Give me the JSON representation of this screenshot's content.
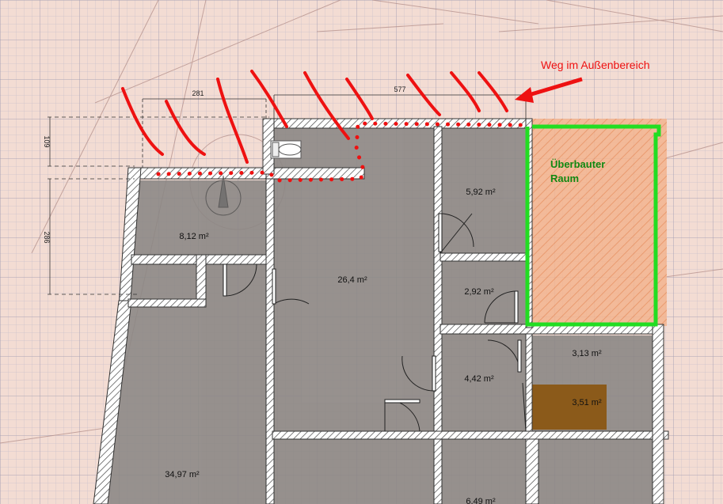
{
  "annotations": {
    "path_label": "Weg im Außenbereich",
    "overbuilt_label_line1": "Überbauter",
    "overbuilt_label_line2": "Raum"
  },
  "dimensions": {
    "top_left": "281",
    "top_right": "577",
    "side_upper": "109",
    "side_lower": "286"
  },
  "rooms": {
    "room_a": "8,12 m²",
    "room_b": "26,4 m²",
    "room_c": "5,92 m²",
    "room_d": "2,92 m²",
    "room_e": "4,42 m²",
    "room_f": "3,13 m²",
    "room_g": "3,51 m²",
    "room_h": "34,97 m²",
    "room_i": "6,49 m²"
  },
  "colors": {
    "annotation_red": "#ee1111",
    "overbuilt_green": "#22dd22",
    "overbuilt_text": "#118811",
    "room_fill": "#8a8684",
    "highlight_room": "#8b5a1a",
    "orange_zone": "#f0a070"
  }
}
